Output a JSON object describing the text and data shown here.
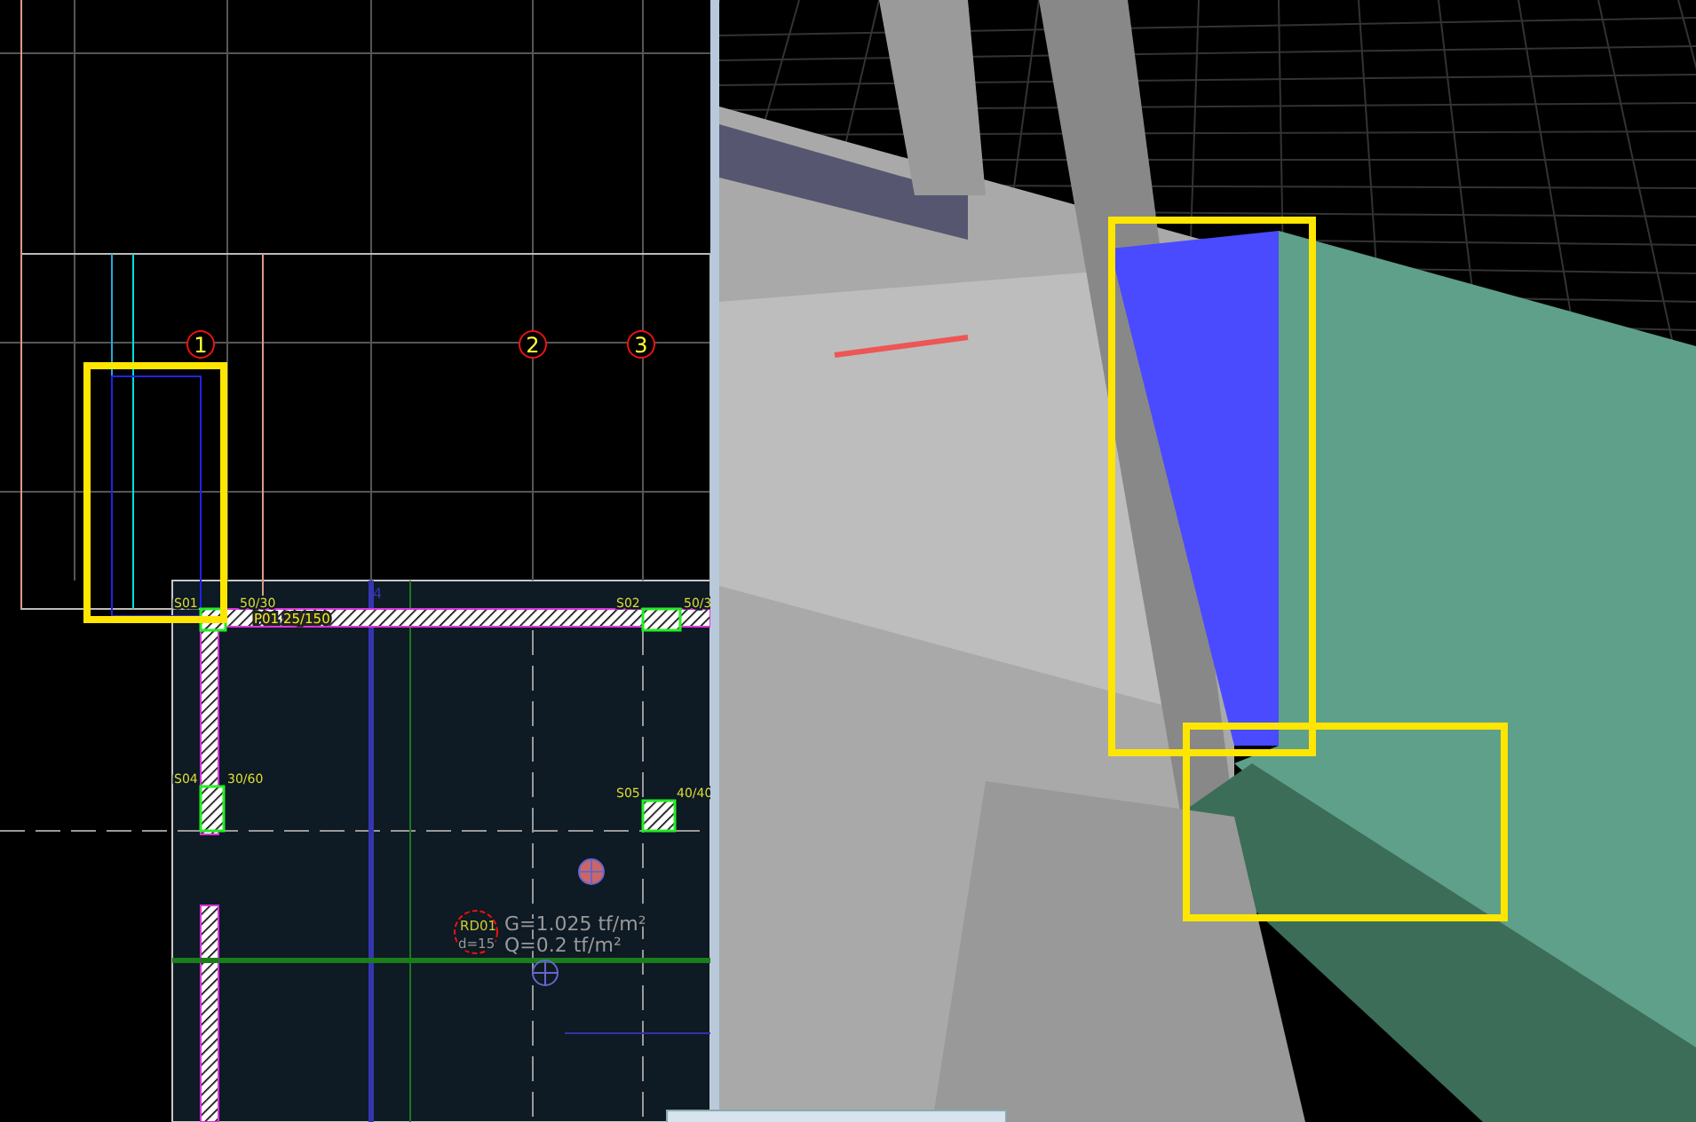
{
  "cad_plan": {
    "grid_bubbles": [
      {
        "label": "1"
      },
      {
        "label": "2"
      },
      {
        "label": "3"
      }
    ],
    "columns": [
      {
        "name": "S01",
        "size": "50/30"
      },
      {
        "name": "S02",
        "size": "50/3"
      },
      {
        "name": "S04",
        "size": "30/60"
      },
      {
        "name": "S05",
        "size": "40/40"
      }
    ],
    "beam_label": "P01 25/150",
    "axis_label": "4",
    "slab": {
      "name": "RD01",
      "thickness": "d=15",
      "loads": [
        "G=1.025 tf/m²",
        "Q=0.2 tf/m²"
      ]
    }
  }
}
